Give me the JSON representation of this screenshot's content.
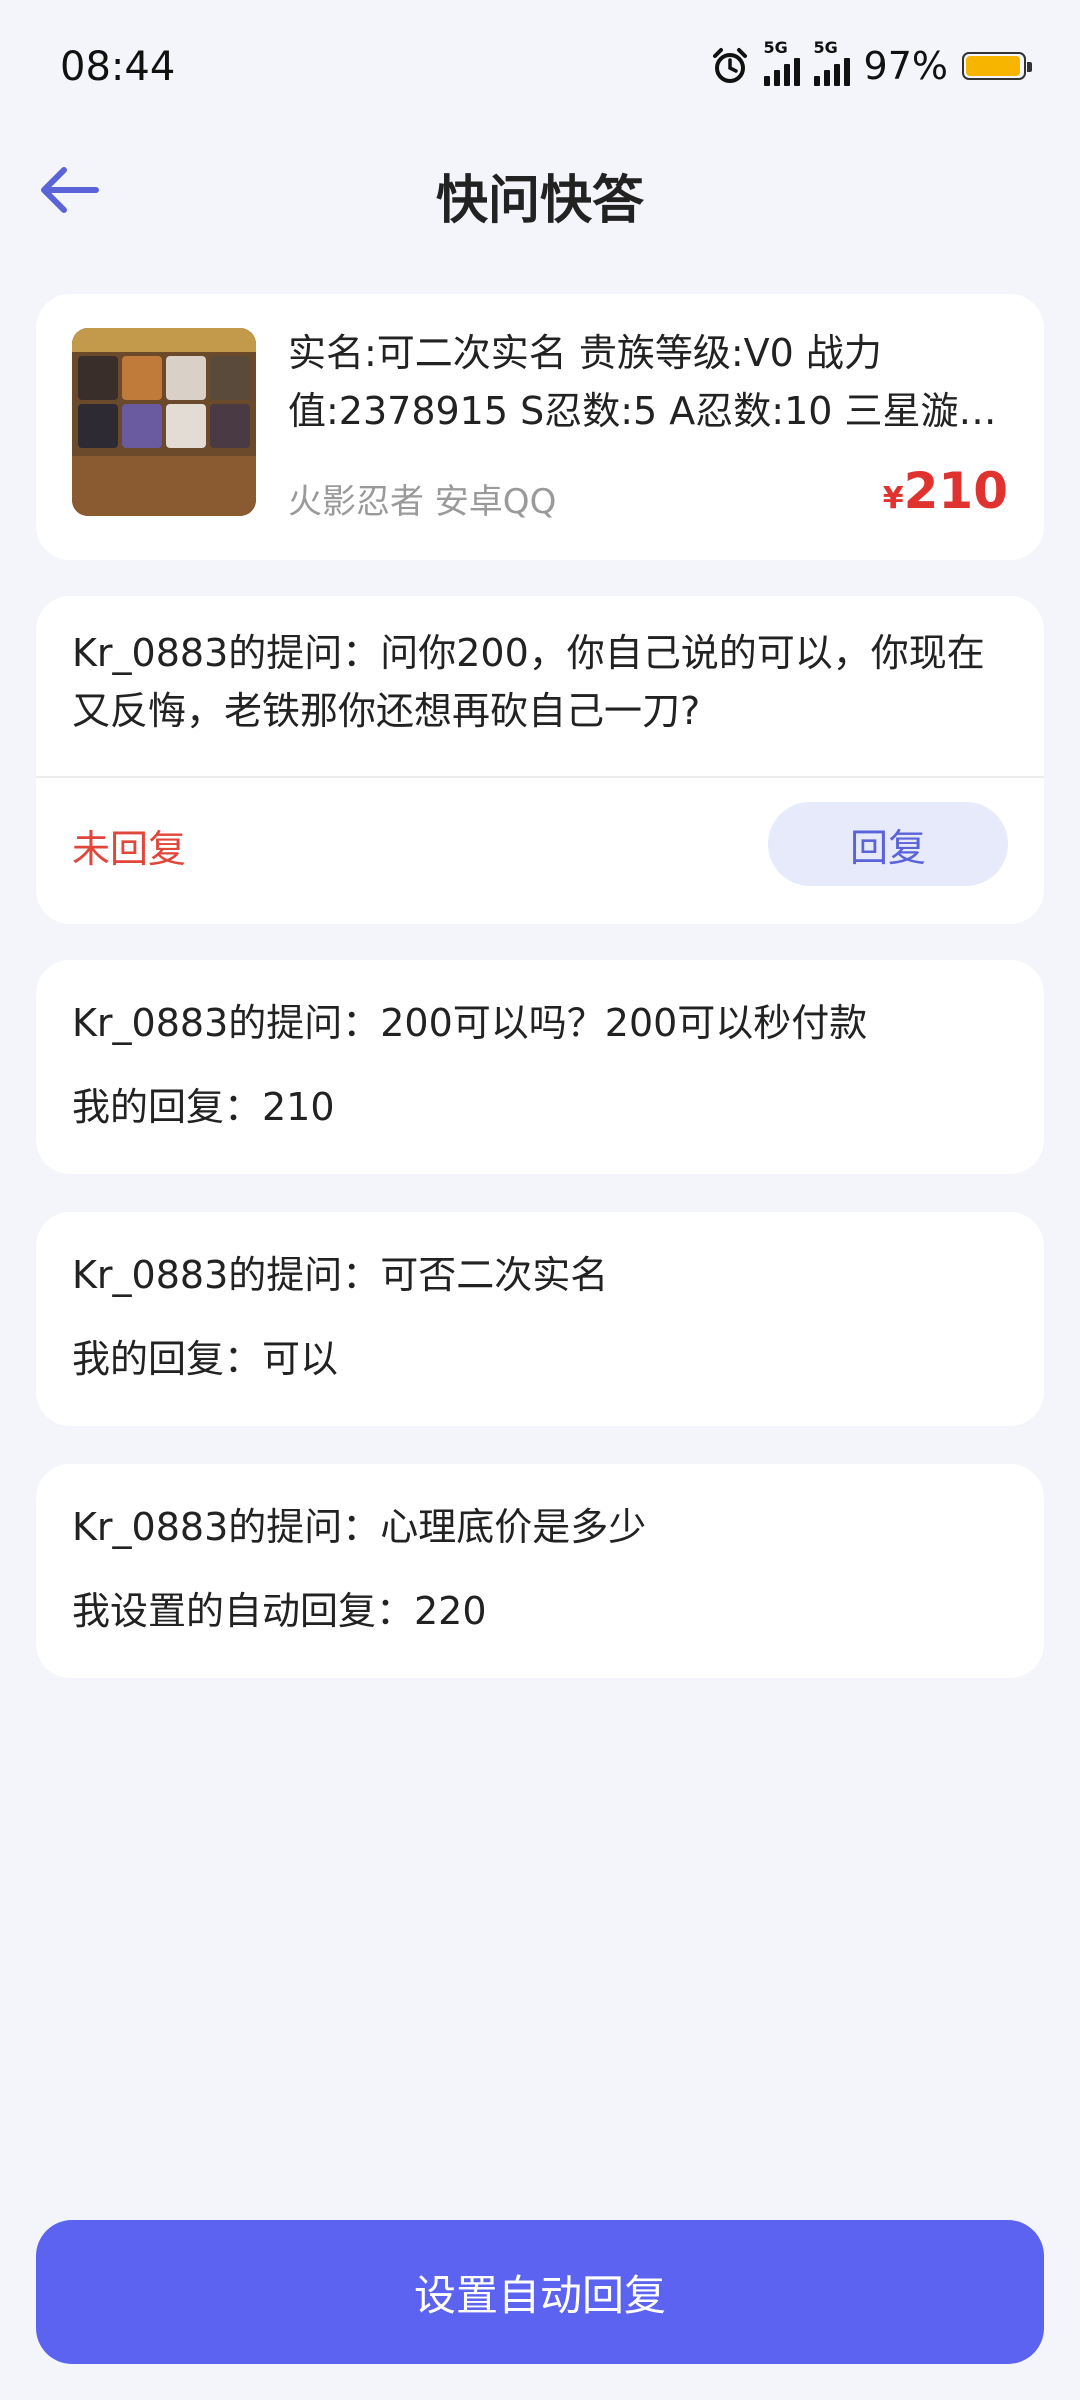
{
  "status_bar": {
    "time": "08:44",
    "network1": "5G",
    "network2": "5G",
    "battery": "97%",
    "battery_level": 0.97
  },
  "header": {
    "title": "快问快答"
  },
  "product": {
    "title": "实名:可二次实名 贵族等级:V0 战力值:2378915 S忍数:5 A忍数:10 三星漩…",
    "subtitle": "火影忍者 安卓QQ",
    "currency": "¥",
    "price": "210"
  },
  "open_question": {
    "question": "Kr_0883的提问：问你200，你自己说的可以，你现在又反悔，老铁那你还想再砍自己一刀?",
    "status": "未回复",
    "reply_label": "回复"
  },
  "qa_list": [
    {
      "question": "Kr_0883的提问：200可以吗？200可以秒付款",
      "answer": "我的回复：210"
    },
    {
      "question": "Kr_0883的提问：可否二次实名",
      "answer": "我的回复：可以"
    },
    {
      "question": "Kr_0883的提问：心理底价是多少",
      "answer": "我设置的自动回复：220"
    }
  ],
  "footer": {
    "auto_reply_label": "设置自动回复"
  },
  "colors": {
    "accent": "#5b63f0",
    "price": "#e0332f",
    "unreplied": "#e0463a"
  }
}
